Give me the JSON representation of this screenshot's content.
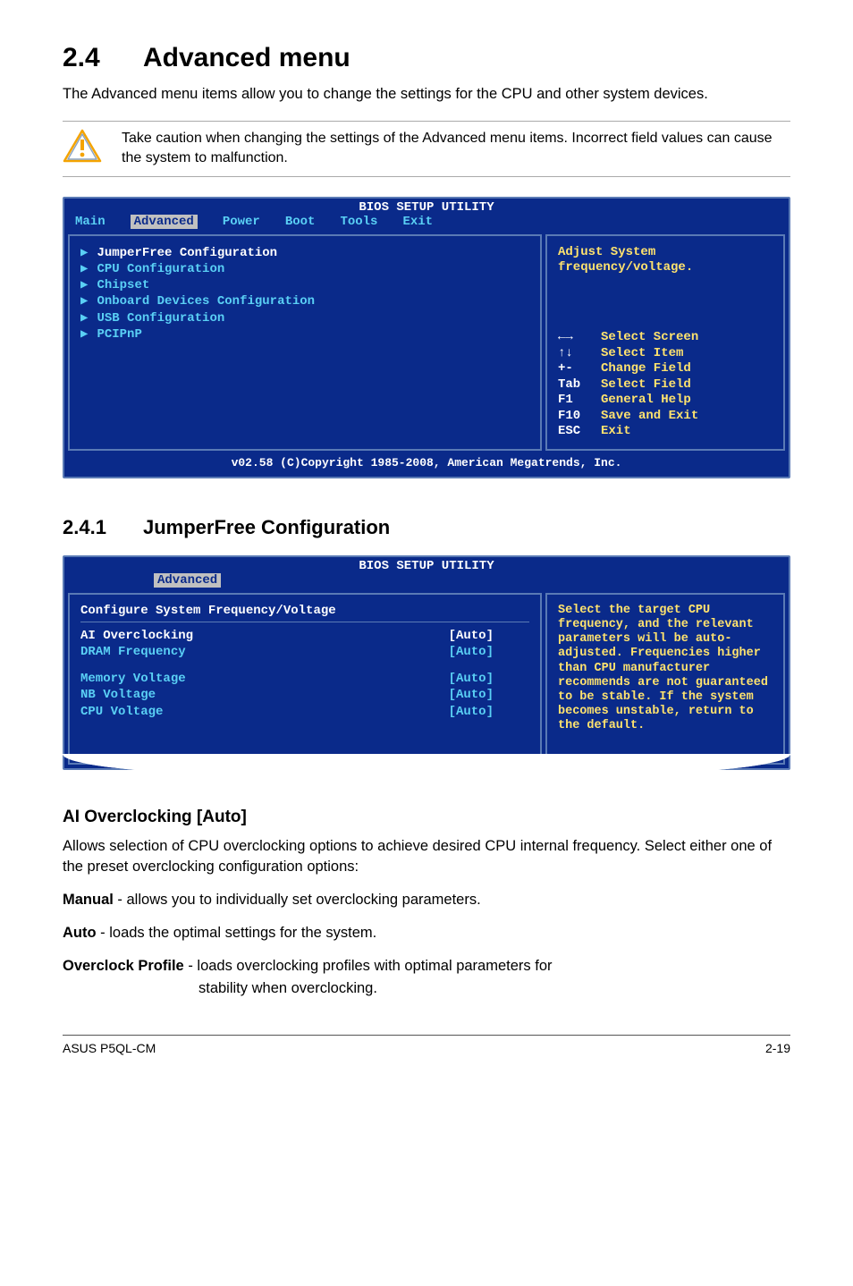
{
  "section": {
    "number": "2.4",
    "title": "Advanced menu",
    "intro": "The Advanced menu items allow you to change the settings for the CPU and other system devices.",
    "callout": "Take caution when changing the settings of the Advanced menu items. Incorrect field values can cause the system to malfunction."
  },
  "bios1": {
    "title": "BIOS SETUP UTILITY",
    "tabs": [
      "Main",
      "Advanced",
      "Power",
      "Boot",
      "Tools",
      "Exit"
    ],
    "selected_tab": "Advanced",
    "menu_items": [
      {
        "label": "JumperFree Configuration",
        "highlight": true
      },
      {
        "label": "CPU Configuration"
      },
      {
        "label": "Chipset"
      },
      {
        "label": "Onboard Devices Configuration"
      },
      {
        "label": "USB Configuration"
      },
      {
        "label": "PCIPnP"
      }
    ],
    "help": {
      "desc_line1": "Adjust System",
      "desc_line2": "frequency/voltage.",
      "nav": [
        {
          "key": "←→",
          "label": "Select Screen"
        },
        {
          "key": "↑↓",
          "label": "Select Item"
        },
        {
          "key": "+-",
          "label": "Change Field"
        },
        {
          "key": "Tab",
          "label": "Select Field"
        },
        {
          "key": "F1",
          "label": "General Help"
        },
        {
          "key": "F10",
          "label": "Save and Exit"
        },
        {
          "key": "ESC",
          "label": "Exit"
        }
      ]
    },
    "footer": "v02.58 (C)Copyright 1985-2008, American Megatrends, Inc."
  },
  "subsection": {
    "number": "2.4.1",
    "title": "JumperFree Configuration"
  },
  "bios2": {
    "title": "BIOS SETUP UTILITY",
    "tab": "Advanced",
    "header": "Configure System Frequency/Voltage",
    "rows": [
      {
        "label": "AI Overclocking",
        "value": "[Auto]",
        "white": true
      },
      {
        "label": "DRAM Frequency",
        "value": "[Auto]"
      },
      {
        "spacer": true
      },
      {
        "label": "Memory Voltage",
        "value": "[Auto]"
      },
      {
        "label": "NB Voltage",
        "value": "[Auto]"
      },
      {
        "label": "CPU Voltage",
        "value": "[Auto]"
      }
    ],
    "help_desc": "Select the target CPU frequency, and the relevant parameters will be auto-adjusted. Frequencies higher than CPU manufacturer recommends are not guaranteed to be stable. If the system becomes unstable, return to the default."
  },
  "item": {
    "title": "AI Overclocking [Auto]",
    "p1": "Allows selection of CPU overclocking options to achieve desired CPU internal frequency. Select either one of the preset overclocking configuration options:",
    "manual_label": "Manual",
    "manual_text": " - allows you to individually set overclocking parameters.",
    "auto_label": "Auto",
    "auto_text": " - loads the optimal settings for the system.",
    "oc_label": "Overclock Profile",
    "oc_text_a": " - loads overclocking profiles with optimal parameters for",
    "oc_text_b": "stability when overclocking."
  },
  "footer": {
    "left": "ASUS P5QL-CM",
    "right": "2-19"
  }
}
